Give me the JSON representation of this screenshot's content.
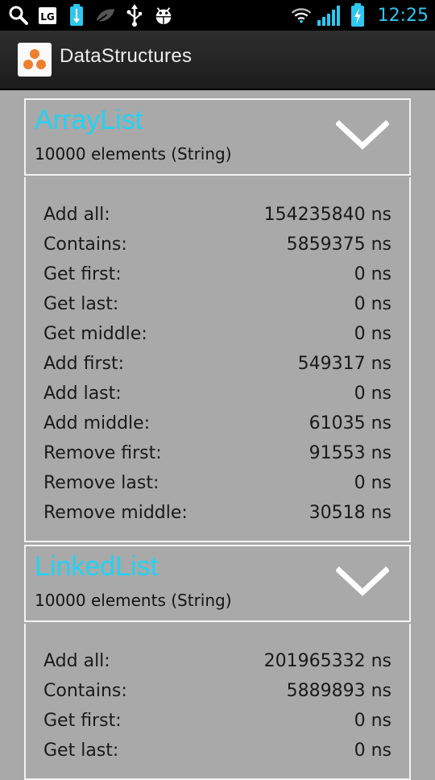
{
  "status_bar": {
    "time": "12:25",
    "left_icons": [
      "search-icon",
      "lg-icon",
      "battery-indicator-icon",
      "leaf-icon",
      "usb-icon",
      "android-debug-icon"
    ],
    "right_icons": [
      "wifi-icon",
      "signal-icon",
      "battery-charging-icon"
    ]
  },
  "action_bar": {
    "title": "DataStructures"
  },
  "cards": [
    {
      "title": "ArrayList",
      "subtitle": "10000 elements (String)",
      "rows": [
        {
          "label": "Add all:",
          "value": "154235840 ns"
        },
        {
          "label": "Contains:",
          "value": "5859375 ns"
        },
        {
          "label": "Get first:",
          "value": "0 ns"
        },
        {
          "label": "Get last:",
          "value": "0 ns"
        },
        {
          "label": "Get middle:",
          "value": "0 ns"
        },
        {
          "label": "Add first:",
          "value": "549317 ns"
        },
        {
          "label": "Add last:",
          "value": "0 ns"
        },
        {
          "label": "Add middle:",
          "value": "61035 ns"
        },
        {
          "label": "Remove first:",
          "value": "91553 ns"
        },
        {
          "label": "Remove last:",
          "value": "0 ns"
        },
        {
          "label": "Remove middle:",
          "value": "30518 ns"
        }
      ]
    },
    {
      "title": "LinkedList",
      "subtitle": "10000 elements (String)",
      "rows": [
        {
          "label": "Add all:",
          "value": "201965332 ns"
        },
        {
          "label": "Contains:",
          "value": "5889893 ns"
        },
        {
          "label": "Get first:",
          "value": "0 ns"
        },
        {
          "label": "Get last:",
          "value": "0 ns"
        }
      ]
    }
  ],
  "colors": {
    "accent": "#22d3f3",
    "background": "#a9a9a9",
    "border": "#f3f3f3"
  }
}
